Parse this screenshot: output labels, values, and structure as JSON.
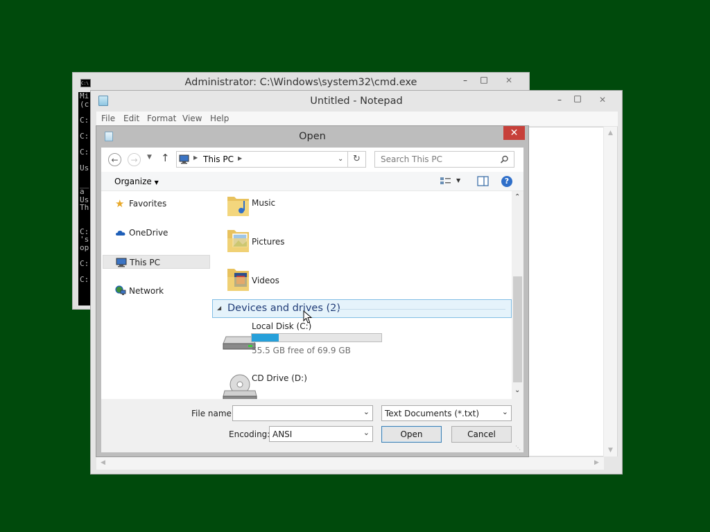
{
  "cmd": {
    "title": "Administrator: C:\\Windows\\system32\\cmd.exe",
    "icon_text": "C:\\",
    "lines": [
      "Mi",
      "(c",
      "",
      "C:",
      "",
      "C:",
      "",
      "C:",
      "",
      "Us",
      "",
      "__",
      "a",
      "Us",
      "Th",
      "",
      "",
      "C:",
      "'s",
      "op",
      "",
      "C:",
      "",
      "C:"
    ]
  },
  "notepad": {
    "title": "Untitled - Notepad",
    "menu": [
      "File",
      "Edit",
      "Format",
      "View",
      "Help"
    ]
  },
  "dialog": {
    "title": "Open",
    "close_glyph": "✕",
    "address": {
      "location": "This PC"
    },
    "search": {
      "placeholder": "Search This PC"
    },
    "toolbar": {
      "organize": "Organize"
    },
    "nav": {
      "favorites": "Favorites",
      "onedrive": "OneDrive",
      "thispc": "This PC",
      "network": "Network"
    },
    "folders": {
      "music": "Music",
      "pictures": "Pictures",
      "videos": "Videos"
    },
    "group_header": "Devices and drives (2)",
    "drives": {
      "c": {
        "name": "Local Disk (C:)",
        "free_text": "55.5 GB free of 69.9 GB",
        "used_fraction": 0.206
      },
      "d": {
        "name": "CD Drive (D:)"
      }
    },
    "file_name": {
      "label": "File name:",
      "value": ""
    },
    "file_type": {
      "value": "Text Documents (*.txt)"
    },
    "encoding": {
      "label": "Encoding:",
      "value": "ANSI"
    },
    "open_button": "Open",
    "cancel_button": "Cancel"
  },
  "colors": {
    "desktop": "#004a0c",
    "close_red": "#c7403a",
    "drive_bar": "#26a0da",
    "group_text": "#1e3a76"
  }
}
